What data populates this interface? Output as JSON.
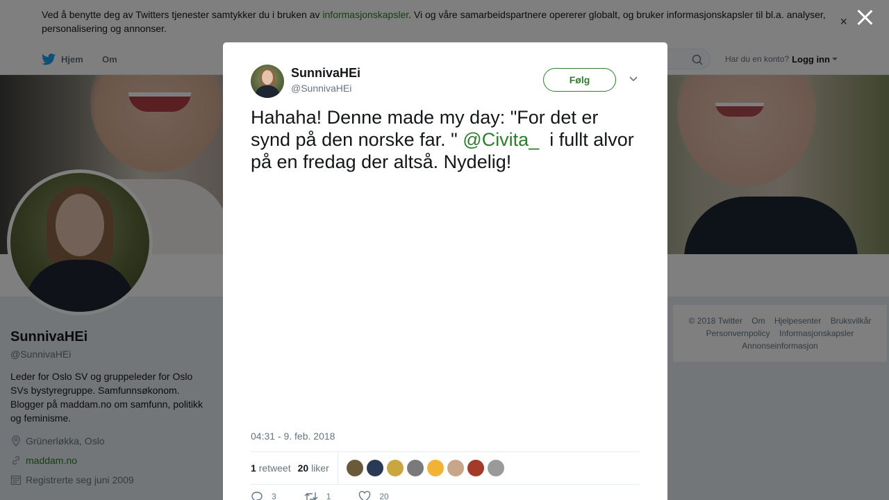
{
  "cookie_bar": {
    "text_before": "Ved å benytte deg av Twitters tjenester samtykker du i bruken av ",
    "link": "informasjonskapsler",
    "text_after": ". Vi og våre samarbeidspartnere opererer globalt, og bruker informasjonskapsler til bl.a. analyser, personalisering og annonser.",
    "close_symbol": "×"
  },
  "nav": {
    "home": "Hjem",
    "about": "Om",
    "login_prompt": "Har du en konto?",
    "login": "Logg inn"
  },
  "profile": {
    "name": "SunnivaHEi",
    "handle": "@SunnivaHEi",
    "bio": "Leder for Oslo SV og gruppeleder for Oslo SVs bystyregruppe. Samfunnsøkonom. Blogger på maddam.no om samfunn, politikk og feminisme.",
    "location": "Grünerløkka, Oslo",
    "website": "maddam.no",
    "joined": "Registrerte seg juni 2009"
  },
  "footer": {
    "links": [
      "© 2018 Twitter",
      "Om",
      "Hjelpesenter",
      "Bruksvilkår",
      "Personvernpolicy",
      "Informasjonskapsler",
      "Annonseinformasjon"
    ]
  },
  "tweet": {
    "name": "SunnivaHEi",
    "handle": "@SunnivaHEi",
    "follow_label": "Følg",
    "text_before": "Hahaha! Denne made my day: \"For det er synd på den norske far. \" ",
    "mention": "@Civita_",
    "text_after": "  i fullt alvor på en fredag der altså. Nydelig!",
    "timestamp": "04:31 - 9. feb. 2018",
    "retweets_count": "1",
    "retweets_label": "retweet",
    "likes_count": "20",
    "likes_label": "liker",
    "reply_count": "3",
    "retweet_action_count": "1",
    "like_action_count": "20"
  },
  "liker_avatars": [
    {
      "name": "liker-avatar-1",
      "color": "#6b5a3a"
    },
    {
      "name": "liker-avatar-2",
      "color": "#2a3a55"
    },
    {
      "name": "liker-avatar-3",
      "color": "#c9a640"
    },
    {
      "name": "liker-avatar-4",
      "color": "#7a7a7a"
    },
    {
      "name": "liker-avatar-5",
      "color": "#f2b235"
    },
    {
      "name": "liker-avatar-6",
      "color": "#c8a68a"
    },
    {
      "name": "liker-avatar-7",
      "color": "#a33a2a"
    },
    {
      "name": "liker-avatar-8",
      "color": "#9a9a9a"
    }
  ],
  "colors": {
    "accent": "#2d7d2d",
    "overlay": "rgba(0,0,0,0.5)"
  }
}
